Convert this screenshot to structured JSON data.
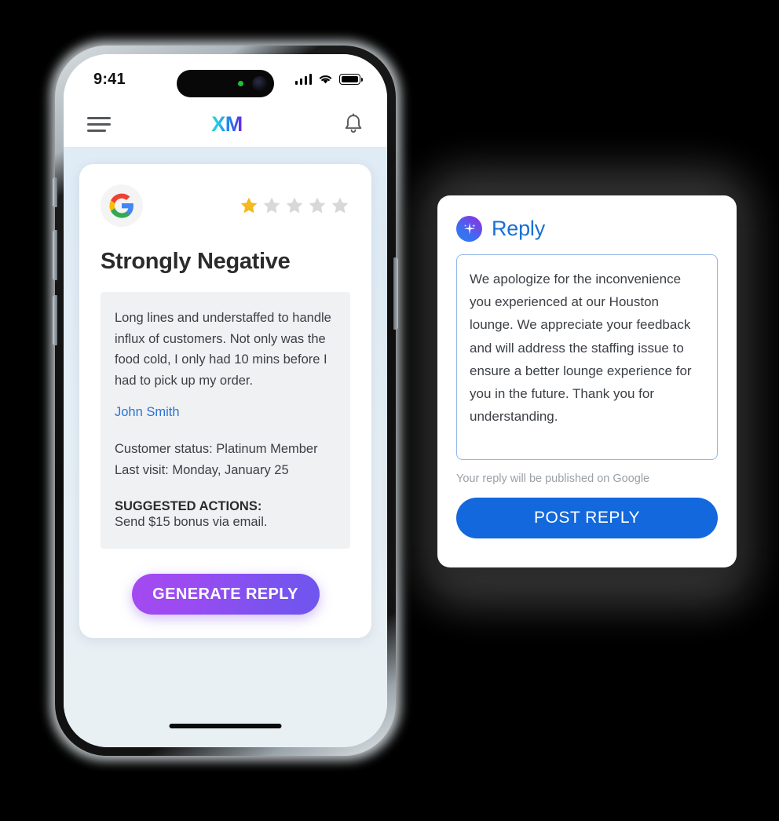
{
  "phone": {
    "status_bar": {
      "time": "9:41",
      "signal_icon": "cellular-signal-icon",
      "wifi_icon": "wifi-icon",
      "battery_icon": "battery-full-icon"
    },
    "header": {
      "menu_icon": "hamburger-menu-icon",
      "logo_text": "XM",
      "bell_icon": "notification-bell-icon"
    },
    "home_indicator": "home-indicator"
  },
  "review_card": {
    "source_icon": "google-logo-icon",
    "rating": {
      "value": 1,
      "max": 5,
      "filled_color": "#f5b820",
      "empty_color": "#d6d8da"
    },
    "sentiment_title": "Strongly Negative",
    "review_text": "Long lines and understaffed to handle influx of customers. Not only was the food cold, I only had 10 mins before I had to pick up my order.",
    "reviewer_name": "John Smith",
    "customer_status": "Customer status: Platinum Member",
    "last_visit": "Last visit: Monday, January 25",
    "suggested_actions_label": "SUGGESTED ACTIONS:",
    "suggested_action": "Send $15 bonus via email.",
    "generate_button_label": "GENERATE REPLY"
  },
  "reply_card": {
    "ai_icon": "ai-sparkle-icon",
    "title": "Reply",
    "reply_text": "We apologize for the inconvenience you experienced at our Houston lounge. We appreciate your feedback and will address the staffing issue to ensure a better lounge experience for you in the future. Thank you for understanding.",
    "note": "Your reply will be published on Google",
    "post_button_label": "POST REPLY"
  },
  "colors": {
    "accent_blue": "#1268dc",
    "link_blue": "#2b72d4",
    "star_gold": "#f5b820",
    "generate_gradient_from": "#a549f0",
    "generate_gradient_to": "#6d56ee"
  }
}
